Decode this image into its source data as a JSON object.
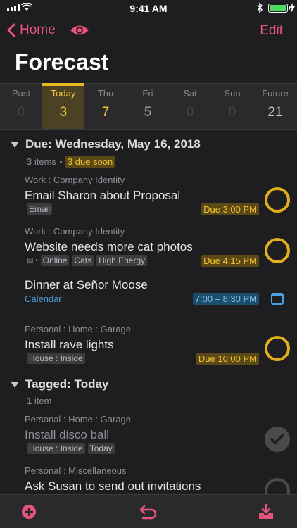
{
  "status": {
    "time": "9:41 AM"
  },
  "nav": {
    "back_label": "Home",
    "edit_label": "Edit"
  },
  "page": {
    "title": "Forecast"
  },
  "days": [
    {
      "name": "Past",
      "count": "0"
    },
    {
      "name": "Today",
      "count": "3"
    },
    {
      "name": "Thu",
      "count": "7"
    },
    {
      "name": "Fri",
      "count": "5"
    },
    {
      "name": "Sat",
      "count": "0"
    },
    {
      "name": "Sun",
      "count": "0"
    },
    {
      "name": "Future",
      "count": "21"
    }
  ],
  "due_section": {
    "header": "Due: Wednesday, May 16, 2018",
    "count": "3 items",
    "soon": "3 due soon"
  },
  "tasks": [
    {
      "context": "Work : Company Identity",
      "title": "Email Sharon about Proposal",
      "tags": [
        "Email"
      ],
      "due": "Due 3:00 PM"
    },
    {
      "context": "Work : Company Identity",
      "title": "Website needs more cat photos",
      "tags": [
        "Online",
        "Cats",
        "High Energy"
      ],
      "due": "Due 4:15 PM"
    },
    {
      "title": "Dinner at Señor Moose",
      "calendar_label": "Calendar",
      "time": "7:00 – 8:30 PM"
    },
    {
      "context": "Personal : Home : Garage",
      "title": "Install rave lights",
      "tags": [
        "House : Inside"
      ],
      "due": "Due 10:00 PM"
    }
  ],
  "tagged_section": {
    "header": "Tagged: Today",
    "count": "1 item"
  },
  "tagged_tasks": [
    {
      "context": "Personal : Home : Garage",
      "title": "Install disco ball",
      "tags": [
        "House : Inside",
        "Today"
      ]
    },
    {
      "context": "Personal : Miscellaneous",
      "title": "Ask Susan to send out invitations"
    }
  ],
  "colors": {
    "accent": "#e8547b",
    "due": "#f0c234",
    "calendar": "#4aa3e0"
  }
}
